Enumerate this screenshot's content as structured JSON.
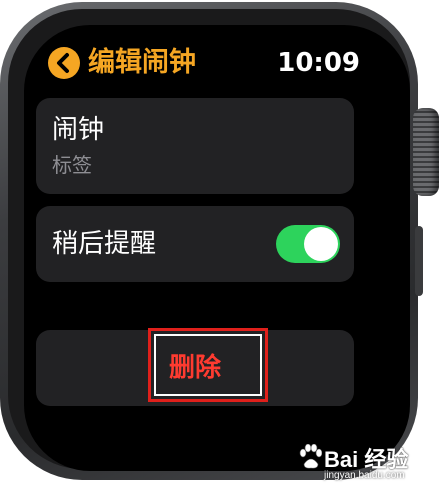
{
  "header": {
    "title": "编辑闹钟",
    "time": "10:09",
    "back_icon": "chevron-left-icon"
  },
  "alarm_cell": {
    "label": "闹钟",
    "sublabel": "标签"
  },
  "snooze_cell": {
    "label": "稍后提醒",
    "toggle_on": true
  },
  "delete_cell": {
    "label": "删除"
  },
  "watermark": {
    "brand": "Bai 经验",
    "url": "jingyan.baidu.com"
  },
  "colors": {
    "accent": "#f5a623",
    "toggle_on": "#2dd35c",
    "destructive": "#ff3b30",
    "cell_bg": "#222224",
    "annotation": "#e0201b"
  }
}
